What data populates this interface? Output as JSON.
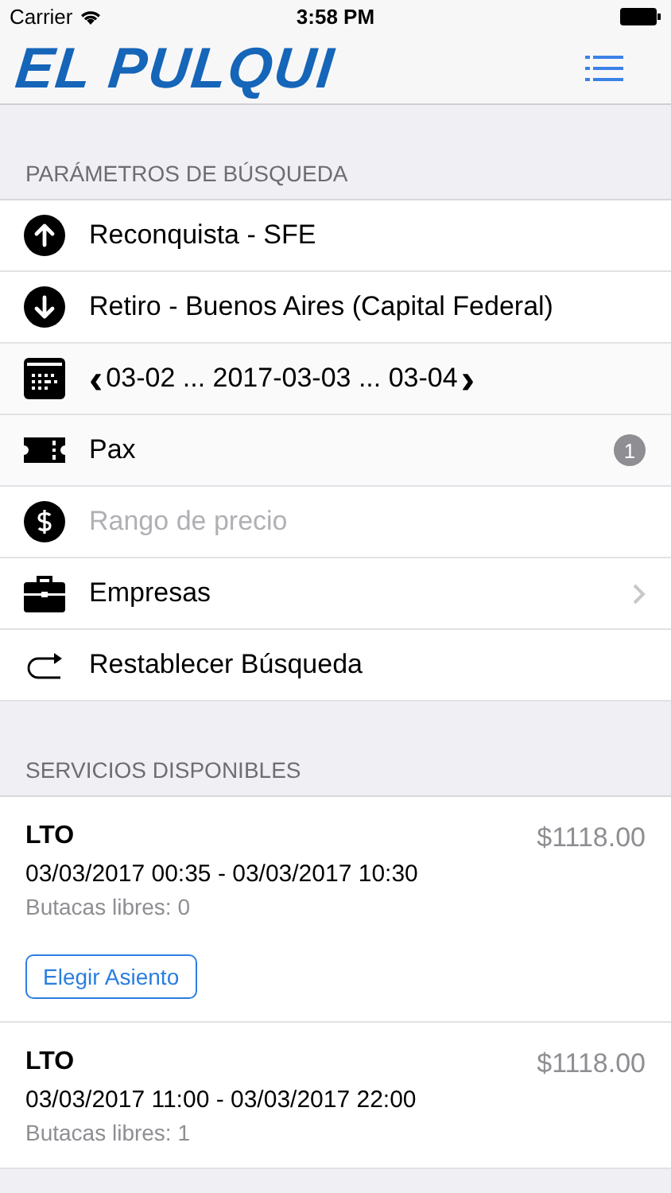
{
  "status_bar": {
    "carrier": "Carrier",
    "time": "3:58 PM"
  },
  "nav": {
    "logo": "EL PULQUI"
  },
  "search": {
    "header": "PARÁMETROS DE BÚSQUEDA",
    "rows": [
      {
        "kind": "origin",
        "value": "Reconquista - SFE"
      },
      {
        "kind": "destination",
        "value": "Retiro - Buenos Aires (Capital Federal)"
      },
      {
        "kind": "date",
        "prev": "‹",
        "value": "03-02 ... 2017-03-03 ... 03-04",
        "next": "›"
      },
      {
        "kind": "passengers",
        "value": "Pax",
        "badge": "1"
      },
      {
        "kind": "price",
        "placeholder": "Rango de precio"
      },
      {
        "kind": "companies",
        "value": "Empresas",
        "disclosure": true
      },
      {
        "kind": "reset",
        "value": "Restablecer Búsqueda"
      }
    ]
  },
  "services": {
    "header": "SERVICIOS DISPONIBLES",
    "items": [
      {
        "name": "LTO",
        "price": "$1118.00",
        "schedule": "03/03/2017 00:35 - 03/03/2017 10:30",
        "seats": "Butacas libres: 0",
        "button": "Elegir Asiento"
      },
      {
        "name": "LTO",
        "price": "$1118.00",
        "schedule": "03/03/2017 11:00 - 03/03/2017 22:00",
        "seats": "Butacas libres: 1"
      }
    ]
  }
}
